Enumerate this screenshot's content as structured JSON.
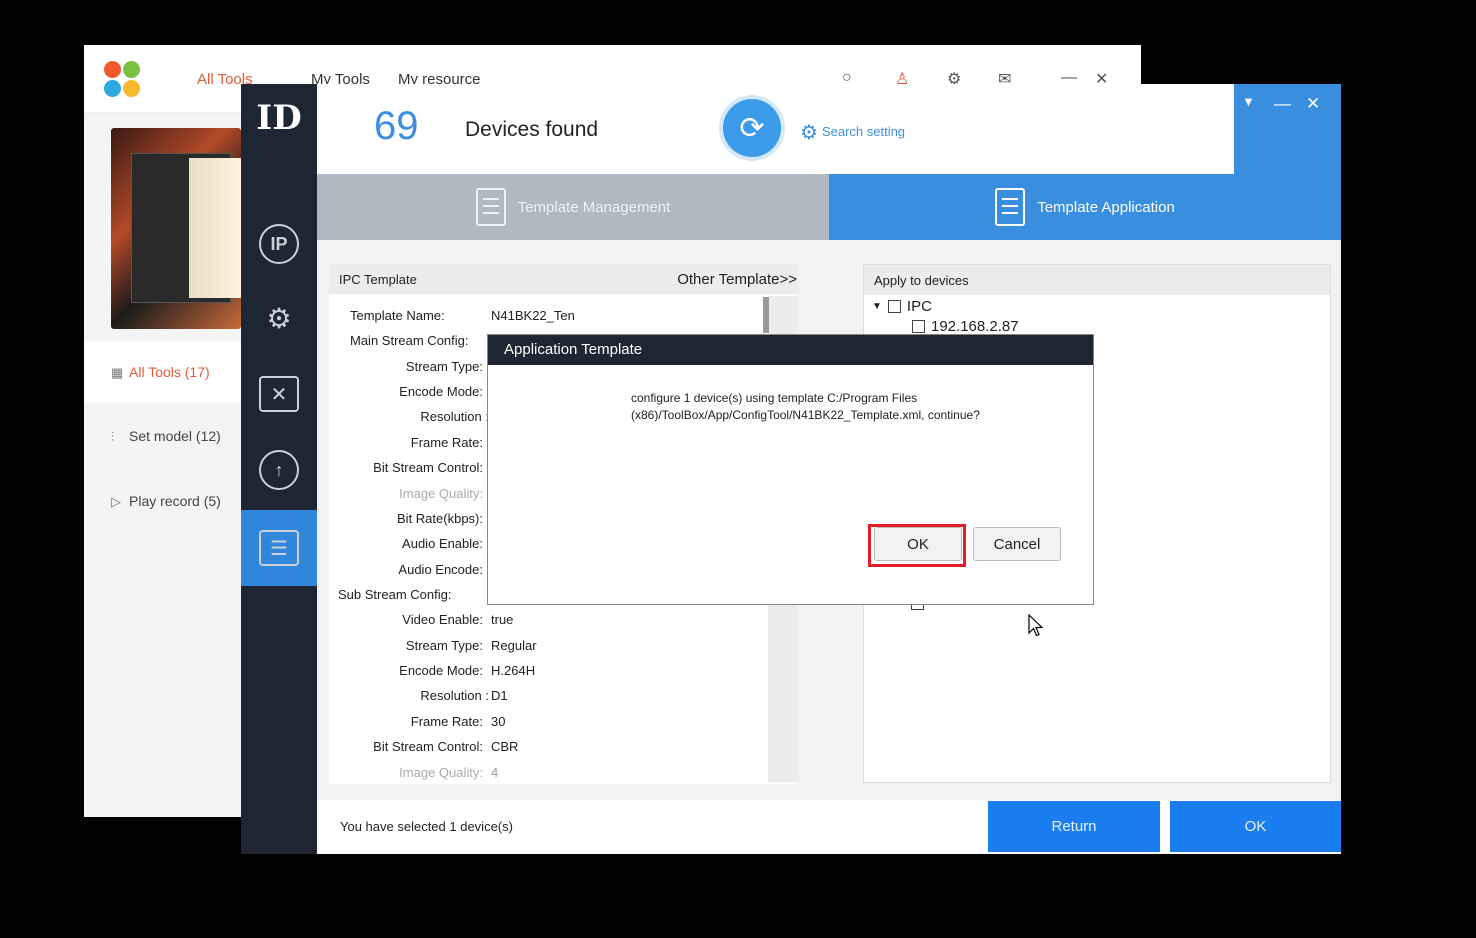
{
  "background_app": {
    "nav": [
      "All Tools",
      "My Tools",
      "My resource"
    ],
    "header_icons": [
      "search-icon",
      "user-icon",
      "settings-icon",
      "message-icon",
      "minimize-icon",
      "close-icon"
    ],
    "menu": [
      {
        "label": "All Tools (17)",
        "icon": "grid-icon"
      },
      {
        "label": "Set model (12)",
        "icon": "sliders-icon"
      },
      {
        "label": "Play record (5)",
        "icon": "play-icon"
      }
    ],
    "accent_color": "#e25b3a"
  },
  "header": {
    "device_count": "69",
    "devices_label": "Devices found",
    "search_setting": "Search setting"
  },
  "tabs": {
    "management": "Template Management",
    "application": "Template Application"
  },
  "ipc_template": {
    "title": "IPC Template",
    "other_link": "Other Template>>",
    "template_name_label": "Template Name:",
    "template_name_value": "N41BK22_Ten",
    "main_stream_label": "Main Stream Config:",
    "main_fields": [
      "Stream Type:",
      "Encode Mode:",
      "Resolution :",
      "Frame Rate:",
      "Bit Stream Control:",
      "Image Quality:",
      "Bit Rate(kbps):",
      "Audio Enable:",
      "Audio Encode:"
    ],
    "sub_stream_label": "Sub Stream Config:",
    "sub_fields": [
      {
        "label": "Video Enable:",
        "value": "true"
      },
      {
        "label": "Stream Type:",
        "value": "Regular"
      },
      {
        "label": "Encode Mode:",
        "value": "H.264H"
      },
      {
        "label": "Resolution :",
        "value": "D1"
      },
      {
        "label": "Frame Rate:",
        "value": "30"
      },
      {
        "label": "Bit Stream Control:",
        "value": "CBR"
      },
      {
        "label": "Image Quality:",
        "value": "4"
      }
    ]
  },
  "apply_devices": {
    "title": "Apply to devices",
    "group": "IPC",
    "devices": [
      "192.168.2.87"
    ]
  },
  "bottom": {
    "selection_text": "You have selected 1 device(s)",
    "return_label": "Return",
    "ok_label": "OK"
  },
  "dialog": {
    "title": "Application Template",
    "message": "configure 1 device(s) using template C:/Program Files (x86)/ToolBox/App/ConfigTool/N41BK22_Template.xml, continue?",
    "ok_label": "OK",
    "cancel_label": "Cancel",
    "highlight_color": "#e41e26"
  },
  "colors": {
    "primary_blue": "#3a8ee0",
    "button_blue": "#1a7ef0",
    "nav_dark": "#1d2632"
  }
}
